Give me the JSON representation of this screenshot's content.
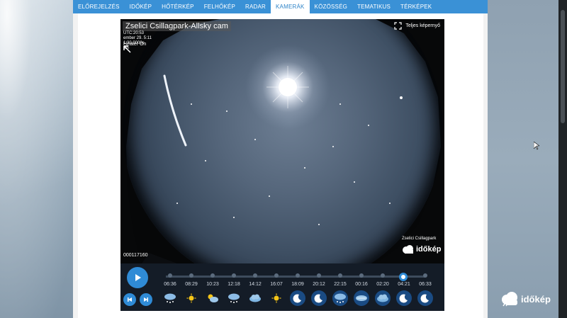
{
  "nav": {
    "items": [
      {
        "label": "ELŐREJELZÉS"
      },
      {
        "label": "IDŐKÉP"
      },
      {
        "label": "HŐTÉRKÉP"
      },
      {
        "label": "FELHŐKÉP"
      },
      {
        "label": "RADAR"
      },
      {
        "label": "KAMERÁK",
        "active": true
      },
      {
        "label": "KÖZÖSSÉG"
      },
      {
        "label": "TEMATIKUS"
      },
      {
        "label": "TÉRKÉPEK"
      }
    ]
  },
  "camera": {
    "title": "Zselici Csillagpark-Allsky cam",
    "meta_line1": "UTC:20:53",
    "meta_line2": "ember 29. 5:11",
    "meta_line3": "1:30.0000s",
    "meta_line4": "km",
    "heater": "Heater On",
    "fullscreen_label": "Teljes képernyő",
    "station_label": "Zselici Csillagpark",
    "logo_text": "időkép",
    "image_id": "000117160"
  },
  "timeline": {
    "labels": [
      "06:36",
      "08:29",
      "10:23",
      "12:18",
      "14:12",
      "16:07",
      "18:09",
      "20:12",
      "22:15",
      "00:16",
      "02:20",
      "04:21",
      "06:33"
    ],
    "icons": [
      "snow-cloud-icon",
      "sun-icon",
      "sun-cloud-icon",
      "snow-cloud-icon",
      "cloud-icon",
      "sun-icon",
      "moon-icon",
      "moon-icon",
      "snow-cloud-icon",
      "moon-cloud-icon",
      "cloud-icon",
      "moon-icon",
      "moon-icon"
    ],
    "current_position": 0.915
  },
  "brand": {
    "text": "időkép"
  },
  "colors": {
    "nav": "#3a91d6",
    "accent": "#2f8bd6",
    "controls_bg": "#141c27"
  }
}
